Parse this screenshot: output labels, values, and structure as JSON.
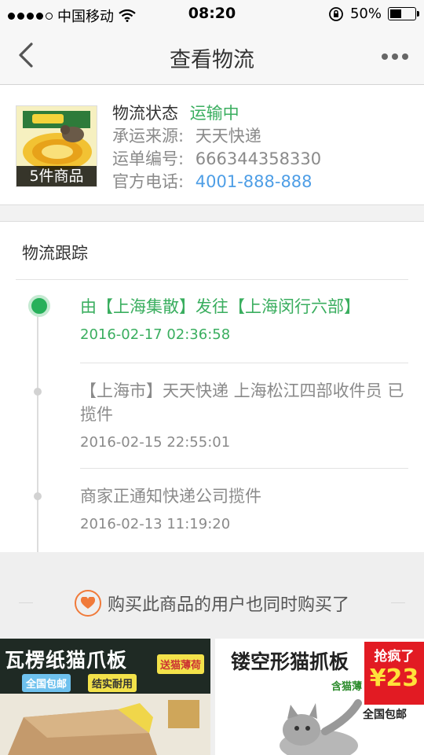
{
  "status_bar": {
    "carrier": "中国移动",
    "time": "08:20",
    "battery": "50%"
  },
  "nav": {
    "title": "查看物流"
  },
  "shipment": {
    "item_count": "5件商品",
    "status_label": "物流状态",
    "status_value": "运输中",
    "carrier_label": "承运来源:",
    "carrier_value": "天天快递",
    "tracking_label": "运单编号:",
    "tracking_value": "666344358330",
    "phone_label": "官方电话:",
    "phone_value": "4001-888-888"
  },
  "tracking": {
    "title": "物流跟踪",
    "events": [
      {
        "text": "由【上海集散】发往【上海闵行六部】",
        "time": "2016-02-17 02:36:58"
      },
      {
        "text": "【上海市】天天快递 上海松江四部收件员 已揽件",
        "time": "2016-02-15 22:55:01"
      },
      {
        "text": "商家正通知快递公司揽件",
        "time": "2016-02-13 11:19:20"
      }
    ]
  },
  "recommend": {
    "label": "购买此商品的用户也同时购买了",
    "products": [
      {
        "title": "瓦楞纸猫爪板",
        "badge_1": "全国包邮",
        "badge_2": "结实耐用",
        "badge_3": "送猫薄荷"
      },
      {
        "title": "镂空形猫抓板",
        "sub": "含猫薄",
        "sale_label": "抢疯了",
        "price": "¥23",
        "shipping": "全国包邮"
      }
    ]
  },
  "colors": {
    "accent_green": "#27b05a",
    "link_blue": "#4e9ee6",
    "heart_orange": "#f07a3a"
  }
}
